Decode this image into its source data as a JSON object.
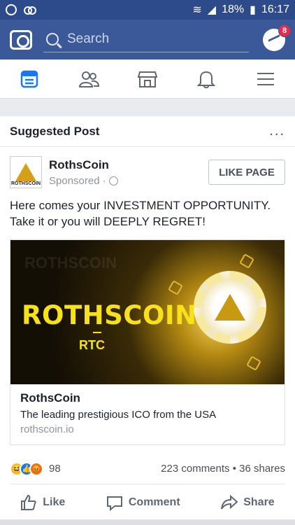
{
  "status_bar": {
    "battery": "18%",
    "time": "16:17"
  },
  "top_bar": {
    "search_placeholder": "Search",
    "messenger_badge": "8"
  },
  "nav": {
    "items": [
      "news-feed",
      "friends",
      "marketplace",
      "notifications",
      "menu"
    ]
  },
  "card": {
    "header": "Suggested Post",
    "more": "...",
    "author_name": "RothsCoin",
    "sponsored": "Sponsored",
    "like_page": "LIKE PAGE",
    "avatar_text": "ROTHSCOIN",
    "text": "Here comes your INVESTMENT OPPORTUNITY. Take it or you will DEEPLY REGRET!",
    "ad": {
      "image_title": "ROTHSCOIN",
      "image_ticker": "RTC",
      "title": "RothsCoin",
      "description": "The leading prestigious ICO from the USA",
      "url": "rothscoin.io"
    },
    "reactions_count": "98",
    "comments_shares": "223 comments • 36 shares",
    "actions": {
      "like": "Like",
      "comment": "Comment",
      "share": "Share"
    }
  }
}
